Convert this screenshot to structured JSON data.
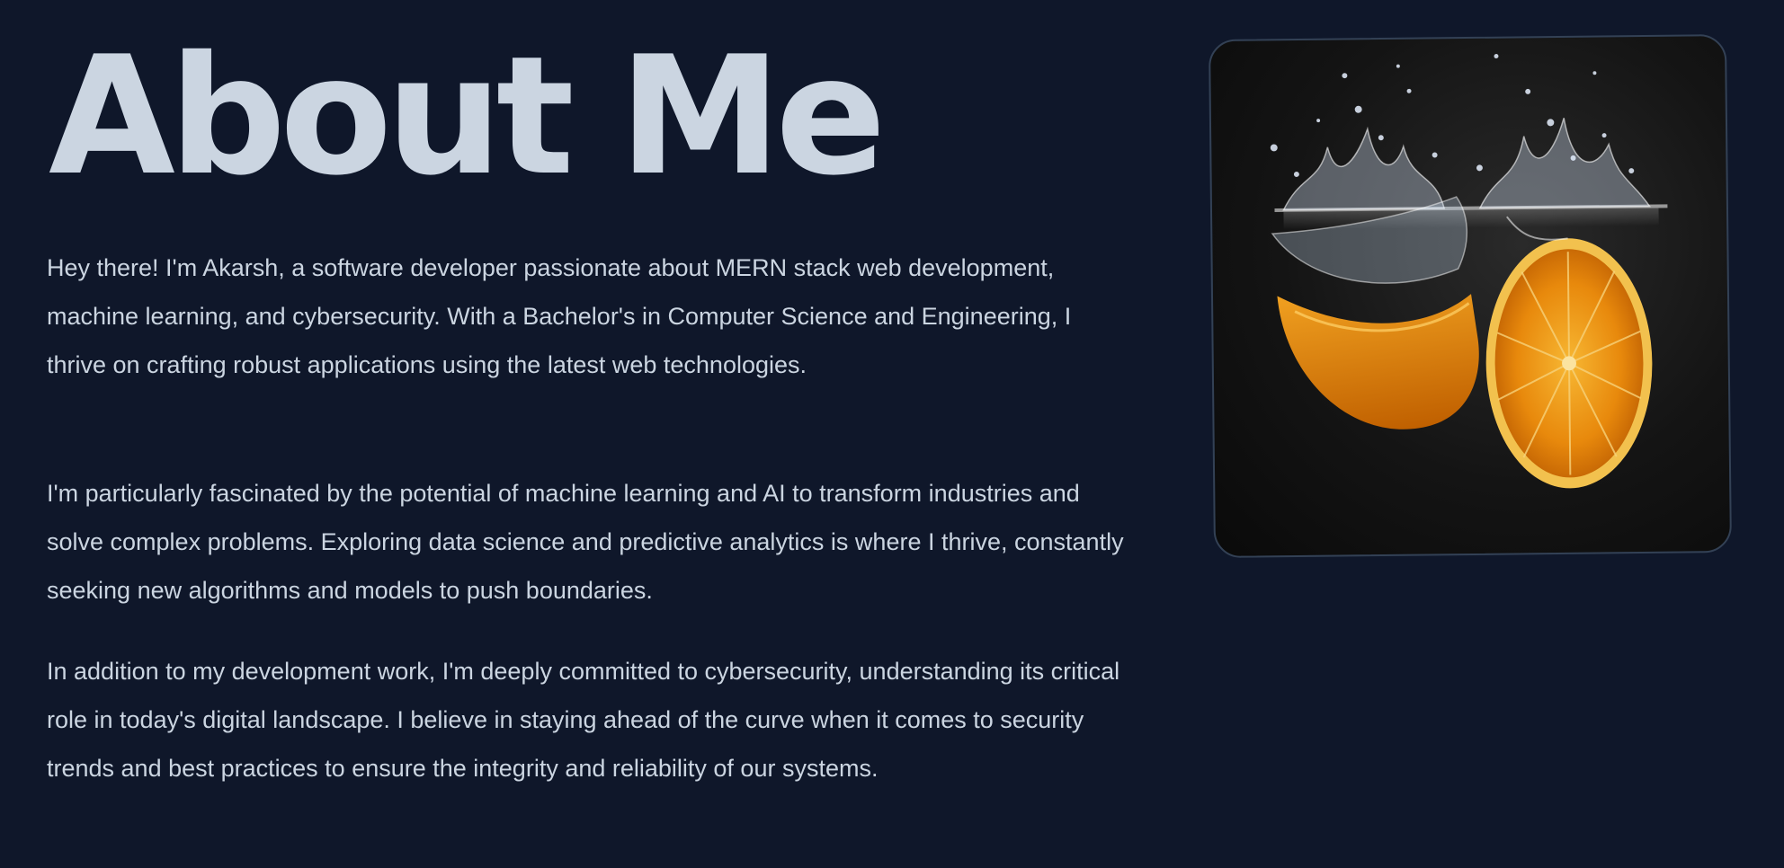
{
  "about": {
    "title": "About Me",
    "paragraphs": [
      "Hey there! I'm Akarsh, a software developer passionate about MERN stack web development, machine learning, and cybersecurity. With a Bachelor's in Computer Science and Engineering, I thrive on crafting robust applications using the latest web technologies.",
      "I'm particularly fascinated by the potential of machine learning and AI to transform industries and solve complex problems. Exploring data science and predictive analytics is where I thrive, constantly seeking new algorithms and models to push boundaries.",
      "In addition to my development work, I'm deeply committed to cybersecurity, understanding its critical role in today's digital landscape. I believe in staying ahead of the curve when it comes to security trends and best practices to ensure the integrity and reliability of our systems."
    ]
  },
  "photo": {
    "subject": "orange-slices-splashing-in-water"
  },
  "colors": {
    "background": "#0f172a",
    "text": "#cbd5e1",
    "frame_border": "#334155",
    "orange": "#f59e0b"
  }
}
